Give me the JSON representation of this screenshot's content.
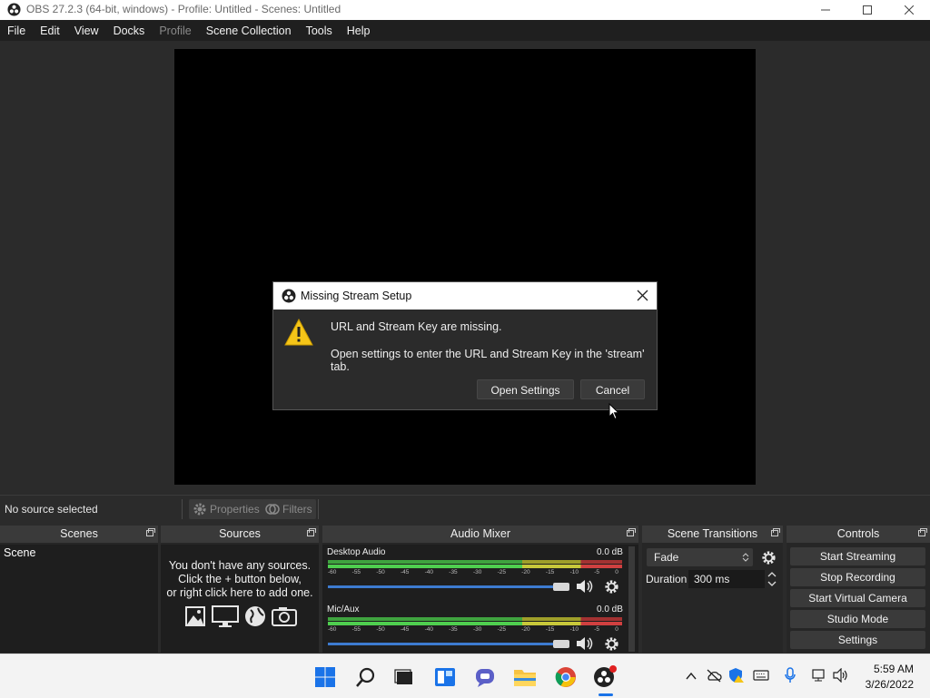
{
  "window": {
    "title": "OBS 27.2.3 (64-bit, windows) - Profile: Untitled - Scenes: Untitled"
  },
  "menu": [
    "File",
    "Edit",
    "View",
    "Docks",
    "Profile",
    "Scene Collection",
    "Tools",
    "Help"
  ],
  "source_toolbar": {
    "status": "No source selected",
    "properties_label": "Properties",
    "filters_label": "Filters"
  },
  "docks": {
    "scenes": {
      "title": "Scenes",
      "items": [
        "Scene"
      ]
    },
    "sources": {
      "title": "Sources",
      "empty_line1": "You don't have any sources.",
      "empty_line2": "Click the + button below,",
      "empty_line3": "or right click here to add one."
    },
    "audio_mixer": {
      "title": "Audio Mixer",
      "scale": [
        "-60",
        "-55",
        "-50",
        "-45",
        "-40",
        "-35",
        "-30",
        "-25",
        "-20",
        "-15",
        "-10",
        "-5",
        "0"
      ],
      "channels": [
        {
          "name": "Desktop Audio",
          "db": "0.0 dB",
          "volume": 1.0
        },
        {
          "name": "Mic/Aux",
          "db": "0.0 dB",
          "volume": 1.0
        }
      ]
    },
    "scene_transitions": {
      "title": "Scene Transitions",
      "transition": "Fade",
      "duration_label": "Duration",
      "duration_value": "300 ms"
    },
    "controls": {
      "title": "Controls",
      "buttons": [
        "Start Streaming",
        "Stop Recording",
        "Start Virtual Camera",
        "Studio Mode",
        "Settings"
      ]
    }
  },
  "dialog": {
    "title": "Missing Stream Setup",
    "message1": "URL and Stream Key are missing.",
    "message2": "Open settings to enter the URL and Stream Key in the 'stream' tab.",
    "open_settings": "Open Settings",
    "cancel": "Cancel"
  },
  "taskbar": {
    "time": "5:59 AM",
    "date": "3/26/2022"
  },
  "colors": {
    "accent_blue": "#3d7bd0",
    "meter_green": "#4fcf4f",
    "meter_yellow": "#c8c83a",
    "meter_red": "#d04040",
    "warning_yellow": "#f5c518"
  }
}
